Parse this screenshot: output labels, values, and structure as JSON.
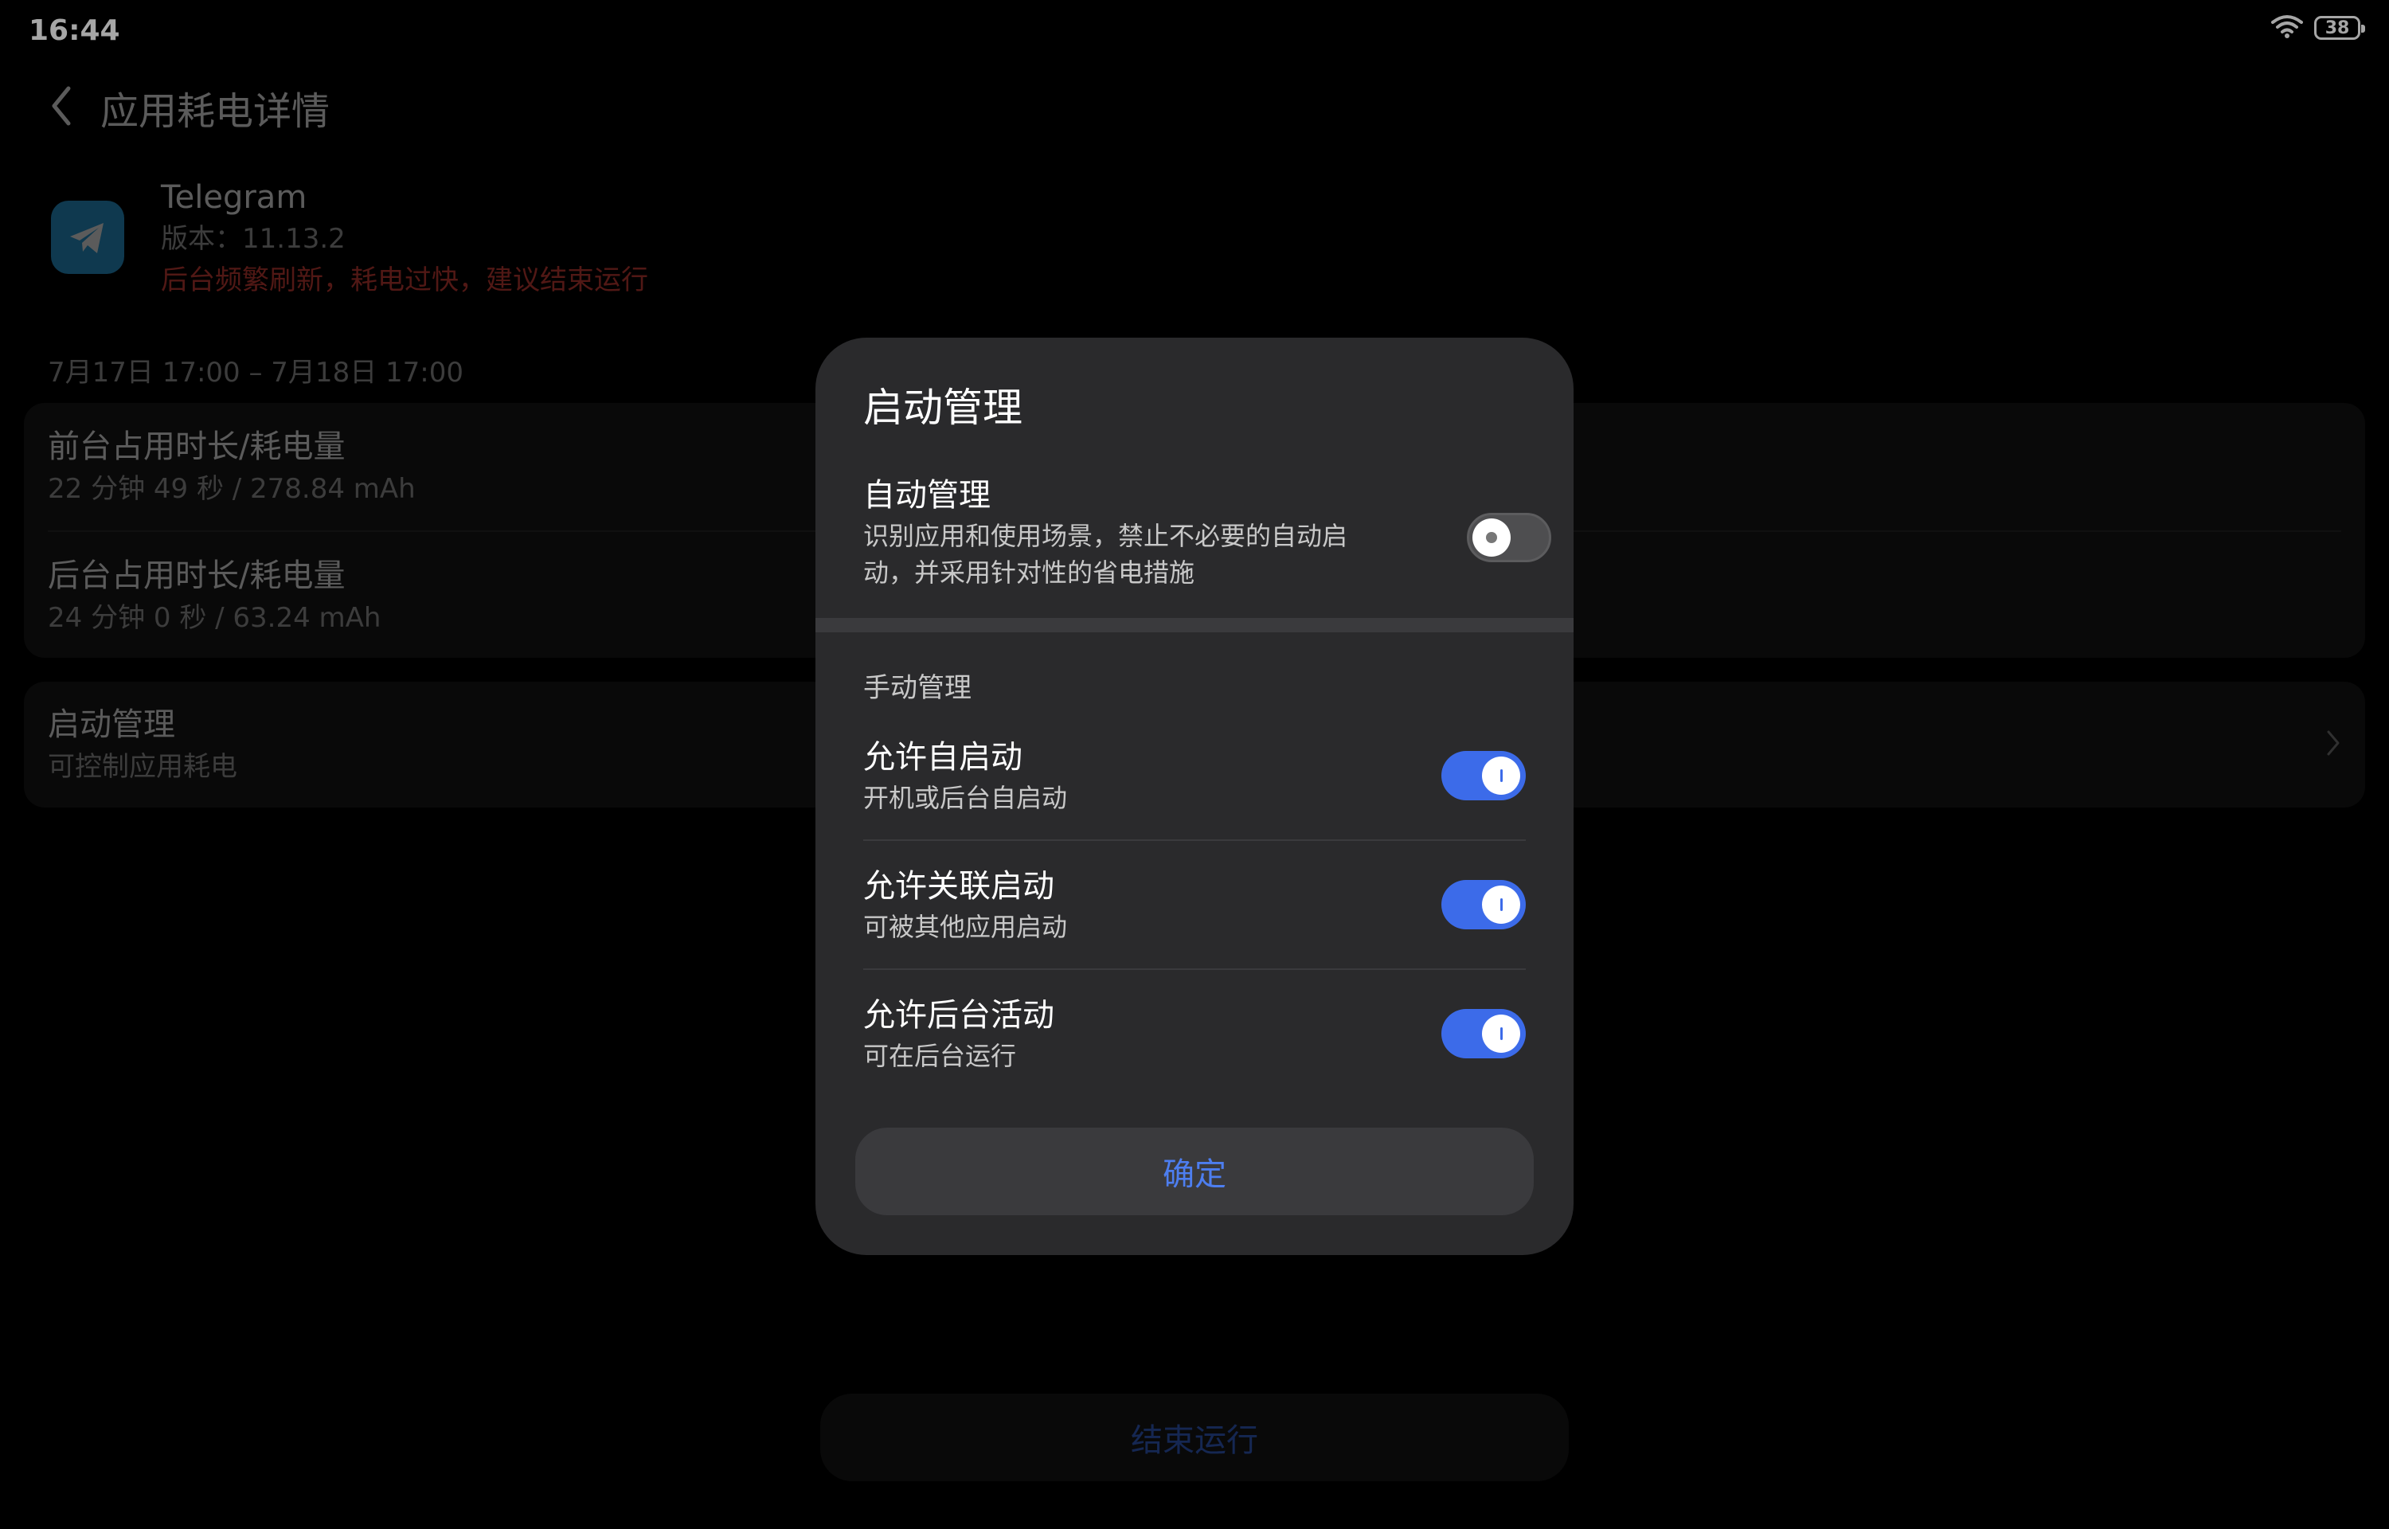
{
  "status_bar": {
    "time": "16:44",
    "battery": "38",
    "wifi_icon": "wifi-icon"
  },
  "header": {
    "back_icon": "chevron-left-icon",
    "title": "应用耗电详情"
  },
  "app": {
    "icon": "telegram-icon",
    "name": "Telegram",
    "version": "版本：11.13.2",
    "warning": "后台频繁刷新，耗电过快，建议结束运行",
    "warning_color": "#e3453c"
  },
  "usage": {
    "date_range": "7月17日 17:00 – 7月18日 17:00",
    "foreground_title": "前台占用时长/耗电量",
    "foreground_value": "22 分钟 49 秒 / 278.84 mAh",
    "background_title": "后台占用时长/耗电量",
    "background_value": "24 分钟 0 秒 / 63.24 mAh"
  },
  "startup_card": {
    "title": "启动管理",
    "subtitle": "可控制应用耗电"
  },
  "end_button": "结束运行",
  "dialog": {
    "title": "启动管理",
    "auto": {
      "title": "自动管理",
      "desc_line1": "识别应用和使用场景，禁止不必要的自动启",
      "desc_line2": "动，并采用针对性的省电措施",
      "enabled": false
    },
    "manual_header": "手动管理",
    "manual_items": [
      {
        "title": "允许自启动",
        "desc": "开机或后台自启动",
        "enabled": true
      },
      {
        "title": "允许关联启动",
        "desc": "可被其他应用启动",
        "enabled": true
      },
      {
        "title": "允许后台活动",
        "desc": "可在后台运行",
        "enabled": true
      }
    ],
    "confirm": "确定"
  },
  "colors": {
    "accent": "#3c6be9",
    "background": "#000000",
    "dialog_bg": "#2a2a2c"
  }
}
